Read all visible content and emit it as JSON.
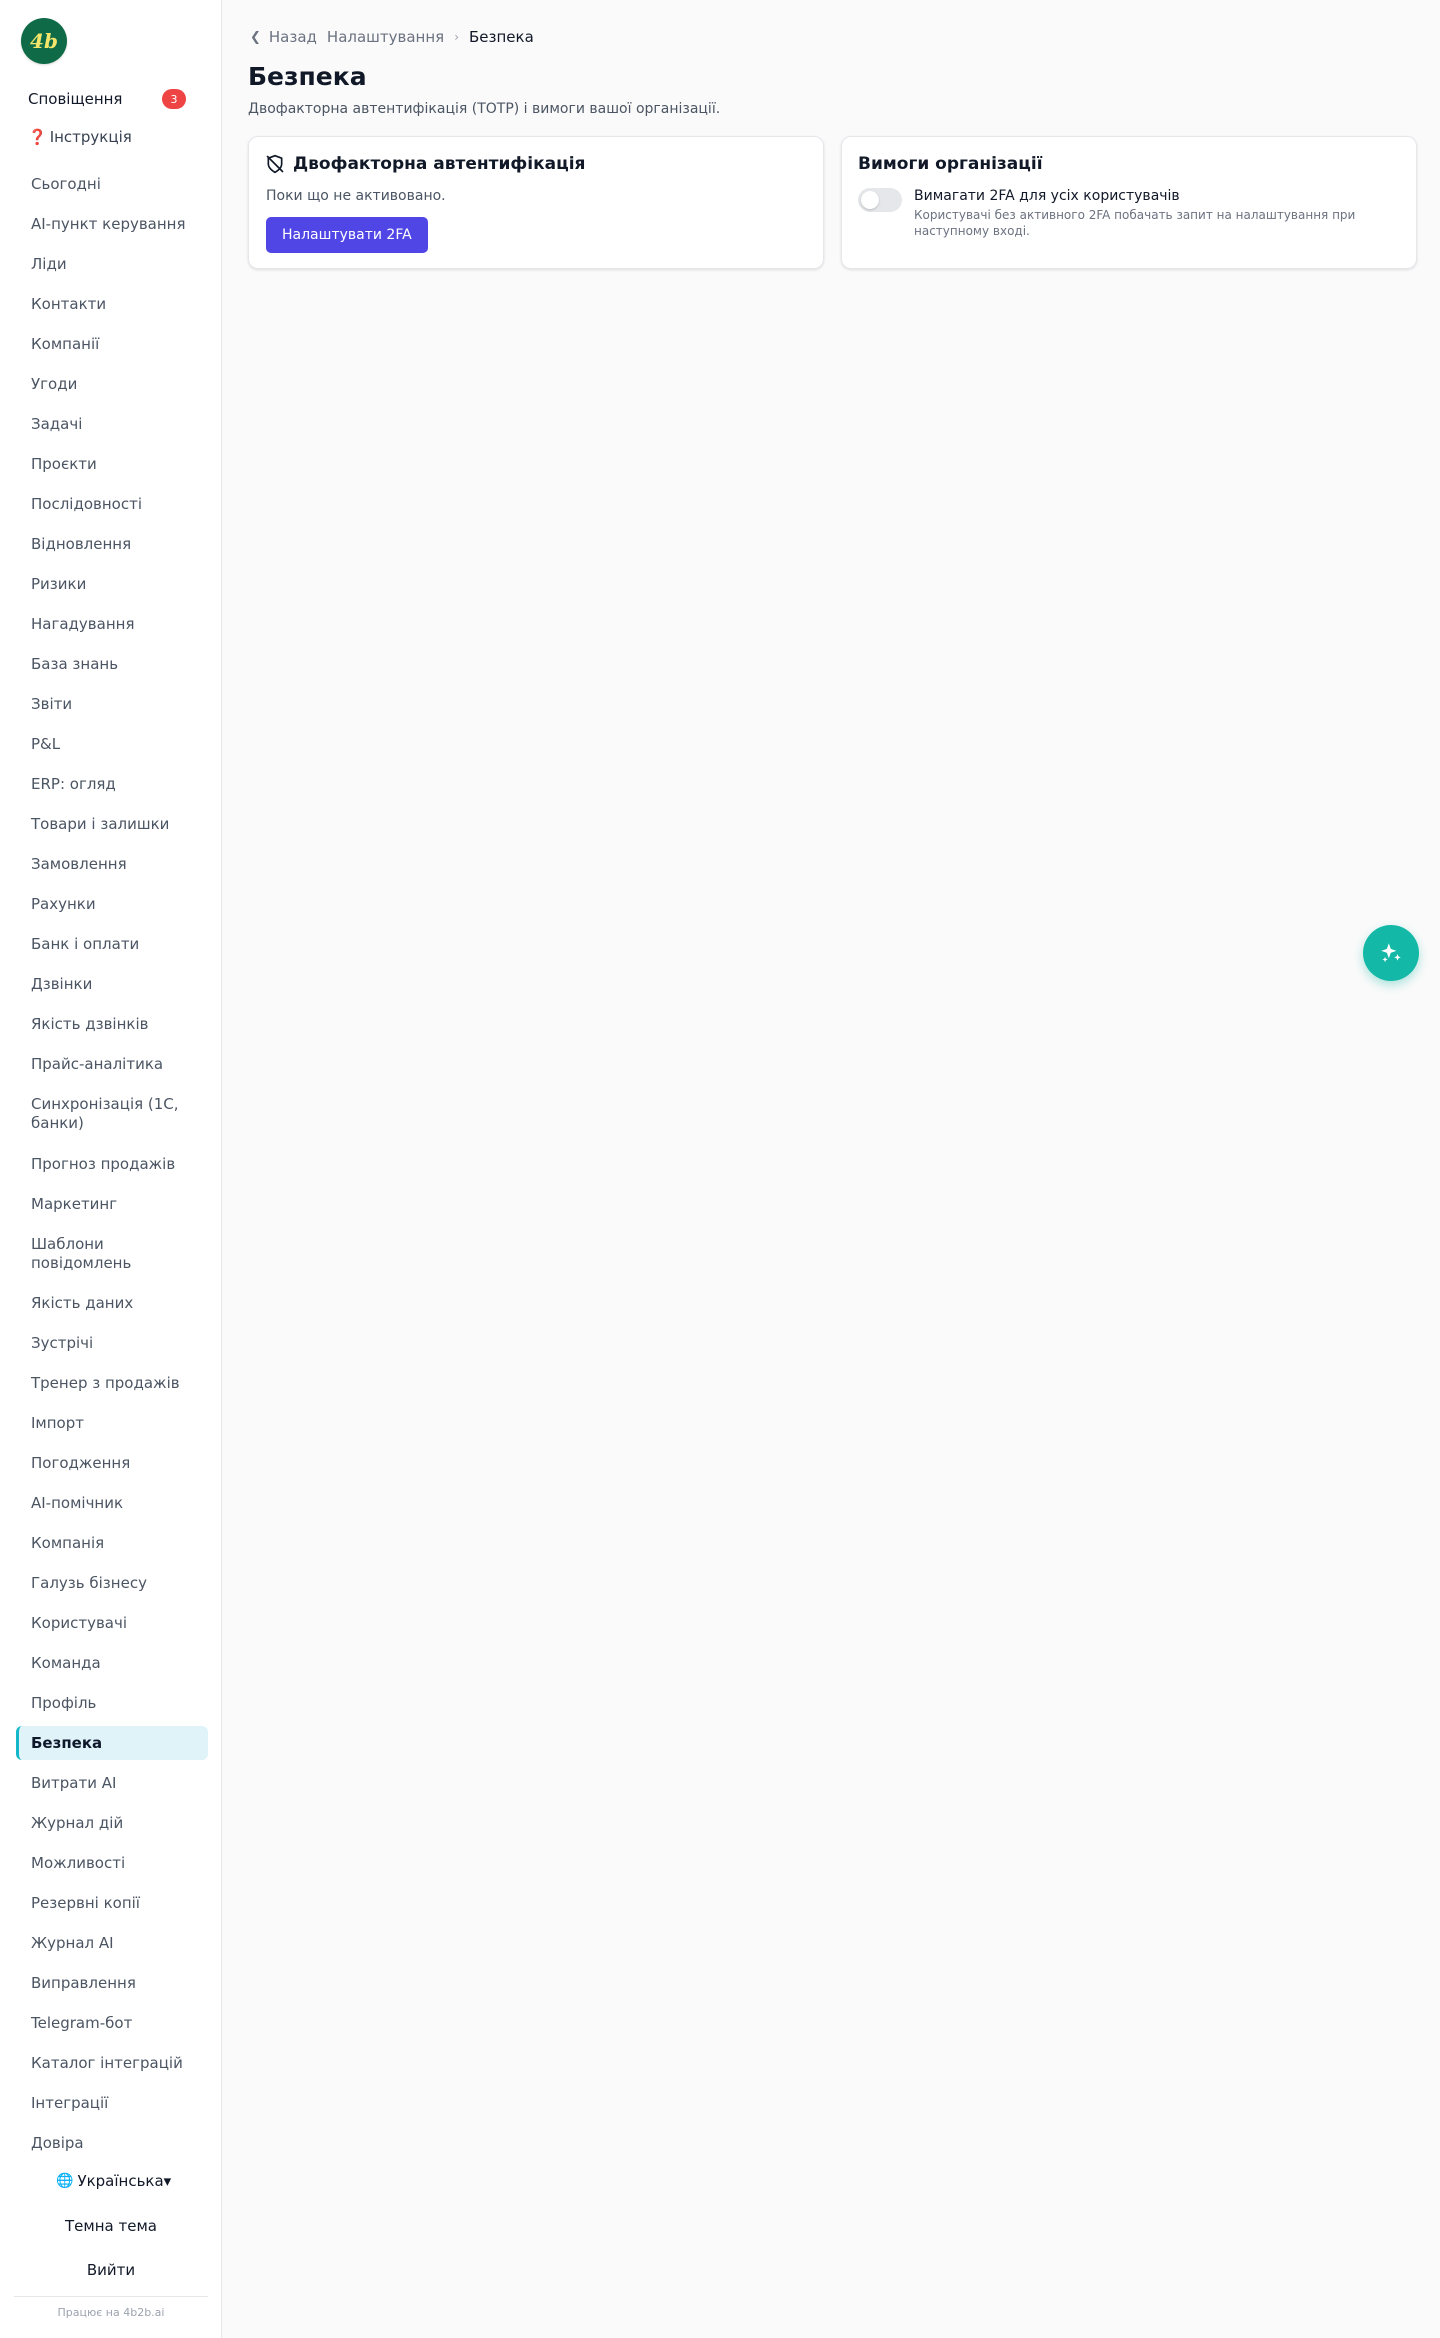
{
  "brand": {
    "logo_text": "4b",
    "logo_color": "#0f6b47"
  },
  "sidebar": {
    "notifications_label": "Сповіщення",
    "notifications_count": "3",
    "help_icon": "❓",
    "help_label": "Інструкція",
    "items": [
      {
        "label": "Сьогодні"
      },
      {
        "label": "AI-пункт керування"
      },
      {
        "label": "Ліди"
      },
      {
        "label": "Контакти"
      },
      {
        "label": "Компанії"
      },
      {
        "label": "Угоди"
      },
      {
        "label": "Задачі"
      },
      {
        "label": "Проєкти"
      },
      {
        "label": "Послідовності"
      },
      {
        "label": "Відновлення"
      },
      {
        "label": "Ризики"
      },
      {
        "label": "Нагадування"
      },
      {
        "label": "База знань"
      },
      {
        "label": "Звіти"
      },
      {
        "label": "P&L"
      },
      {
        "label": "ERP: огляд"
      },
      {
        "label": "Товари і залишки"
      },
      {
        "label": "Замовлення"
      },
      {
        "label": "Рахунки"
      },
      {
        "label": "Банк і оплати"
      },
      {
        "label": "Дзвінки"
      },
      {
        "label": "Якість дзвінків"
      },
      {
        "label": "Прайс-аналітика"
      },
      {
        "label": "Синхронізація (1С, банки)"
      },
      {
        "label": "Прогноз продажів"
      },
      {
        "label": "Маркетинг"
      },
      {
        "label": "Шаблони повідомлень"
      },
      {
        "label": "Якість даних"
      },
      {
        "label": "Зустрічі"
      },
      {
        "label": "Тренер з продажів"
      },
      {
        "label": "Імпорт"
      },
      {
        "label": "Погодження"
      },
      {
        "label": "AI-помічник"
      },
      {
        "label": "Компанія"
      },
      {
        "label": "Галузь бізнесу"
      },
      {
        "label": "Користувачі"
      },
      {
        "label": "Команда"
      },
      {
        "label": "Профіль"
      },
      {
        "label": "Безпека",
        "active": true
      },
      {
        "label": "Витрати AI"
      },
      {
        "label": "Журнал дій"
      },
      {
        "label": "Можливості"
      },
      {
        "label": "Резервні копії"
      },
      {
        "label": "Журнал AI"
      },
      {
        "label": "Виправлення"
      },
      {
        "label": "Telegram-бот"
      },
      {
        "label": "Каталог інтеграцій"
      },
      {
        "label": "Інтеграції"
      },
      {
        "label": "Довіра"
      }
    ],
    "language": {
      "icon": "🌐",
      "label": "Українська▾"
    },
    "theme_label": "Темна тема",
    "logout_label": "Вийти",
    "powered_by": "Працює на 4b2b.ai"
  },
  "breadcrumb": {
    "back_label": "Назад",
    "parent_label": "Налаштування",
    "separator": "›",
    "current_label": "Безпека"
  },
  "page": {
    "title": "Безпека",
    "subtitle": "Двофакторна автентифікація (TOTP) і вимоги вашої організації."
  },
  "two_factor_card": {
    "title": "Двофакторна автентифікація",
    "icon": "shield-off-icon",
    "status": "Поки що не активовано.",
    "setup_button": "Налаштувати 2FA"
  },
  "org_card": {
    "title": "Вимоги організації",
    "toggle_label": "Вимагати 2FA для усіх користувачів",
    "toggle_on": false,
    "toggle_help": "Користувачі без активного 2FA побачать запит на налаштування при наступному вході."
  },
  "fab": {
    "icon": "sparkles-icon"
  },
  "colors": {
    "accent": "#4f46e5",
    "active_nav_bg": "#dff3f9",
    "active_nav_border": "#14b8c8",
    "badge": "#ef4444",
    "fab": "#14b8a6"
  }
}
